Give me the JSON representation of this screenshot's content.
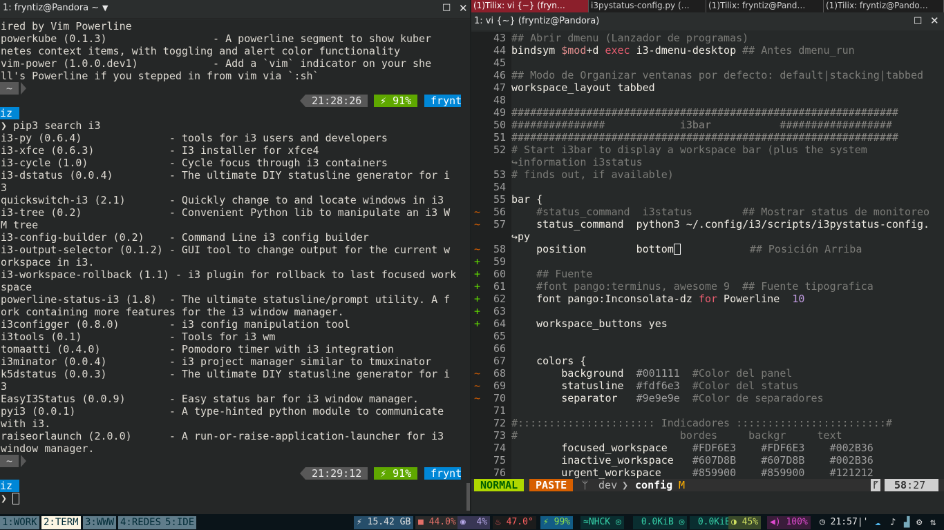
{
  "left_pane": {
    "title": "1: fryntiz@Pandora ~",
    "dropdown_icon": "chevron-down-icon",
    "maximize_icon": "maximize-icon",
    "close_icon": "close-icon",
    "lines": [
      "ired by Vim Powerline",
      "powerkube (0.1.3)                 - A powerline segment to show kuber",
      "netes context items, with toggling and alert color functionality",
      "vim-power (1.0.0.dev1)            - Add a `vim` indicator on your she",
      "ll's Powerline if you stepped in from vim via `:sh`"
    ],
    "prompt1": {
      "tilde": " ~ ",
      "time": " 21:28:26 ",
      "battery": " ⚡ 91% ",
      "user": " frynt",
      "user_wrap": "iz"
    },
    "command": "❯ pip3 search i3",
    "results": [
      "i3-py (0.6.4)              - tools for i3 users and developers",
      "i3-xfce (0.6.3)            - I3 installer for xfce4",
      "i3-cycle (1.0)             - Cycle focus through i3 containers",
      "i3-dstatus (0.0.4)         - The ultimate DIY statusline generator for i",
      "3",
      "quickswitch-i3 (2.1)       - Quickly change to and locate windows in i3",
      "i3-tree (0.2)              - Convenient Python lib to manipulate an i3 W",
      "M tree",
      "i3-config-builder (0.2)    - Command Line i3 config builder",
      "i3-output-selector (0.1.2) - GUI tool to change output for the current w",
      "orkspace in i3.",
      "i3-workspace-rollback (1.1) - i3 plugin for rollback to last focused work",
      "space",
      "powerline-status-i3 (1.8)  - The ultimate statusline/prompt utility. A f",
      "ork containing more features for the i3 window manager.",
      "i3configger (0.8.0)        - i3 config manipulation tool",
      "i3tools (0.1)              - Tools for i3 wm",
      "tomaatti (0.4.0)           - Pomodoro timer with i3 integration",
      "i3minator (0.0.4)          - i3 project manager similar to tmuxinator",
      "k5dstatus (0.0.3)          - The ultimate DIY statusline generator for i",
      "3",
      "EasyI3Status (0.0.9)       - Easy status bar for i3 window manager.",
      "pyi3 (0.0.1)               - A type-hinted python module to communicate",
      "with i3.",
      "raiseorlaunch (2.0.0)      - A run-or-raise-application-launcher for i3",
      "window manager."
    ],
    "prompt2": {
      "tilde": " ~ ",
      "time": " 21:29:12 ",
      "battery": " ⚡ 91% ",
      "user": " frynt",
      "user_wrap": "iz"
    },
    "final_prompt": "❯ "
  },
  "right_pane": {
    "tabs": [
      "(1)Tilix: vi {~} (fryn…",
      "i3pystatus-config.py (…",
      "(1)Tilix: fryntiz@Pand…",
      "(1)Tilix: fryntiz@Pando…"
    ],
    "title": "1: vi {~} (fryntiz@Pandora)",
    "maximize_icon": "maximize-icon",
    "close_icon": "close-icon",
    "vim_lines": [
      {
        "n": "43",
        "s": "",
        "t": "## Abrir dmenu (Lanzador de programas)",
        "k": "cmt"
      },
      {
        "n": "44",
        "s": "",
        "t": "bindsym $mod+d exec i3-dmenu-desktop ## Antes dmenu_run",
        "k": "bind"
      },
      {
        "n": "45",
        "s": "",
        "t": "",
        "k": ""
      },
      {
        "n": "46",
        "s": "",
        "t": "## Modo de Organizar ventanas por defecto: default|stacking|tabbed",
        "k": "cmt"
      },
      {
        "n": "47",
        "s": "",
        "t": "workspace_layout tabbed",
        "k": ""
      },
      {
        "n": "48",
        "s": "",
        "t": "",
        "k": ""
      },
      {
        "n": "49",
        "s": "",
        "t": "##############################################################",
        "k": "hash"
      },
      {
        "n": "50",
        "s": "",
        "t": "###############            i3bar           ##################",
        "k": "hash"
      },
      {
        "n": "51",
        "s": "",
        "t": "##############################################################",
        "k": "hash"
      },
      {
        "n": "52",
        "s": "",
        "t": "# Start i3bar to display a workspace bar (plus the system",
        "k": "cmt"
      },
      {
        "n": "",
        "s": "",
        "t": "↪information i3status",
        "k": "cmt"
      },
      {
        "n": "53",
        "s": "",
        "t": "# finds out, if available)",
        "k": "cmt"
      },
      {
        "n": "54",
        "s": "",
        "t": "",
        "k": ""
      },
      {
        "n": "55",
        "s": "",
        "t": "bar {",
        "k": ""
      },
      {
        "n": "56",
        "s": "~",
        "t": "    #status_command  i3status        ## Mostrar status de monitoreo",
        "k": "cmt"
      },
      {
        "n": "57",
        "s": "~",
        "t": "    status_command  python3 ~/.config/i3/scripts/i3pystatus-config.",
        "k": ""
      },
      {
        "n": "",
        "s": "",
        "t": "↪py",
        "k": ""
      },
      {
        "n": "58",
        "s": "~",
        "t": "    position        bottom",
        "k": "pos"
      },
      {
        "n": "59",
        "s": "+",
        "t": "",
        "k": ""
      },
      {
        "n": "60",
        "s": "+",
        "t": "    ## Fuente",
        "k": "cmt"
      },
      {
        "n": "61",
        "s": "+",
        "t": "    #font pango:terminus, awesome 9  ## Fuente tipografica",
        "k": "cmt"
      },
      {
        "n": "62",
        "s": "+",
        "t": "    font pango:Inconsolata-dz for Powerline  10",
        "k": "font"
      },
      {
        "n": "63",
        "s": "+",
        "t": "",
        "k": ""
      },
      {
        "n": "64",
        "s": "+",
        "t": "    workspace_buttons yes",
        "k": ""
      },
      {
        "n": "65",
        "s": "",
        "t": "",
        "k": ""
      },
      {
        "n": "66",
        "s": "",
        "t": "",
        "k": ""
      },
      {
        "n": "67",
        "s": "",
        "t": "    colors {",
        "k": ""
      },
      {
        "n": "68",
        "s": "~",
        "t": "        background  #001111  #Color del panel",
        "k": "color"
      },
      {
        "n": "69",
        "s": "~",
        "t": "        statusline  #fdf6e3  #Color del status",
        "k": "color"
      },
      {
        "n": "70",
        "s": "~",
        "t": "        separator   #9e9e9e  #Color de separadores",
        "k": "color"
      },
      {
        "n": "71",
        "s": "",
        "t": "",
        "k": ""
      },
      {
        "n": "72",
        "s": "",
        "t": "#:::::::::::::::::::::: Indicadores ::::::::::::::::::::::::#",
        "k": "cmt"
      },
      {
        "n": "73",
        "s": "",
        "t": "#                          bordes     backgr     text",
        "k": "cmt"
      },
      {
        "n": "74",
        "s": "",
        "t": "        focused_workspace    #FDF6E3    #FDF6E3    #002B36",
        "k": "ws"
      },
      {
        "n": "75",
        "s": "",
        "t": "        inactive_workspace   #607D8B    #607D8B    #002B36",
        "k": "ws"
      },
      {
        "n": "76",
        "s": "",
        "t": "        urgent_workspace     #859900    #859900    #121212",
        "k": "ws"
      }
    ],
    "inline": {
      "bind_pre": "bindsym ",
      "bind_var": "$mod",
      "bind_mid": "+d ",
      "bind_kw": "exec",
      "bind_rest": " i3-dmenu-desktop ",
      "bind_cmt": "## Antes dmenu_run",
      "pos_comment": "## Posición Arriba",
      "font_pre": "    font pango:Inconsolata-dz ",
      "font_kw": "for",
      "font_mid": " Powerline  ",
      "font_num": "10"
    },
    "statusline": {
      "mode": " NORMAL ",
      "paste": " PASTE ",
      "branch_icon": "branch-icon",
      "branch": " dev ",
      "file": " config ",
      "modified": "M",
      "ln_icon": "⹍",
      "position_line": "58",
      "position_col": ":27"
    }
  },
  "i3bar": {
    "workspaces": [
      {
        "label": "1:WORK",
        "active": false
      },
      {
        "label": "2:TERM",
        "active": true
      },
      {
        "label": "3:WWW",
        "active": false
      },
      {
        "label": "4:REDES",
        "active": false
      },
      {
        "label": "5:IDE",
        "active": false
      }
    ],
    "status": {
      "disk": "⚡ 15.42 GB",
      "mem": "■ 44.0%",
      "cpu": "◉  4%",
      "temp": "♨ 47.0°",
      "battery": "⚡ 99%",
      "network": "≈NHCK ◎",
      "down": " 0.0KiB ◎",
      "up": " 0.0KiB",
      "brightness": "◑ 45%",
      "volume": "◀) 100%",
      "clock": "◷ 21:57|'"
    },
    "tray_icons": [
      "cloud-icon",
      "volume-icon",
      "signal-icon",
      "settings-icon",
      "network-icon"
    ]
  },
  "colors": {
    "tilix_active_tab": "#8b1f2b",
    "powerline_time_bg": "#585858",
    "powerline_battery_bg": "#5fa800",
    "powerline_user_bg": "#0087d7",
    "vim_normal_bg": "#afd700",
    "vim_paste_bg": "#d75f00",
    "active_workspace_bg": "#fdf6e3"
  }
}
